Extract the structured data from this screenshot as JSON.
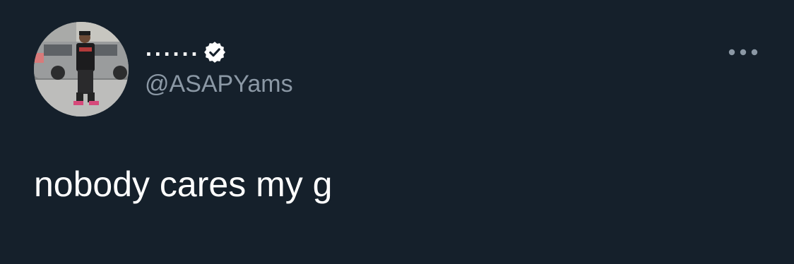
{
  "tweet": {
    "display_name": "......",
    "handle": "@ASAPYams",
    "verified": true,
    "text": "nobody cares my g"
  },
  "icons": {
    "verified": "verified-badge-icon",
    "more": "more-horizontal-icon"
  },
  "colors": {
    "background": "#15202b",
    "text_primary": "#ffffff",
    "text_secondary": "#8b98a5"
  }
}
